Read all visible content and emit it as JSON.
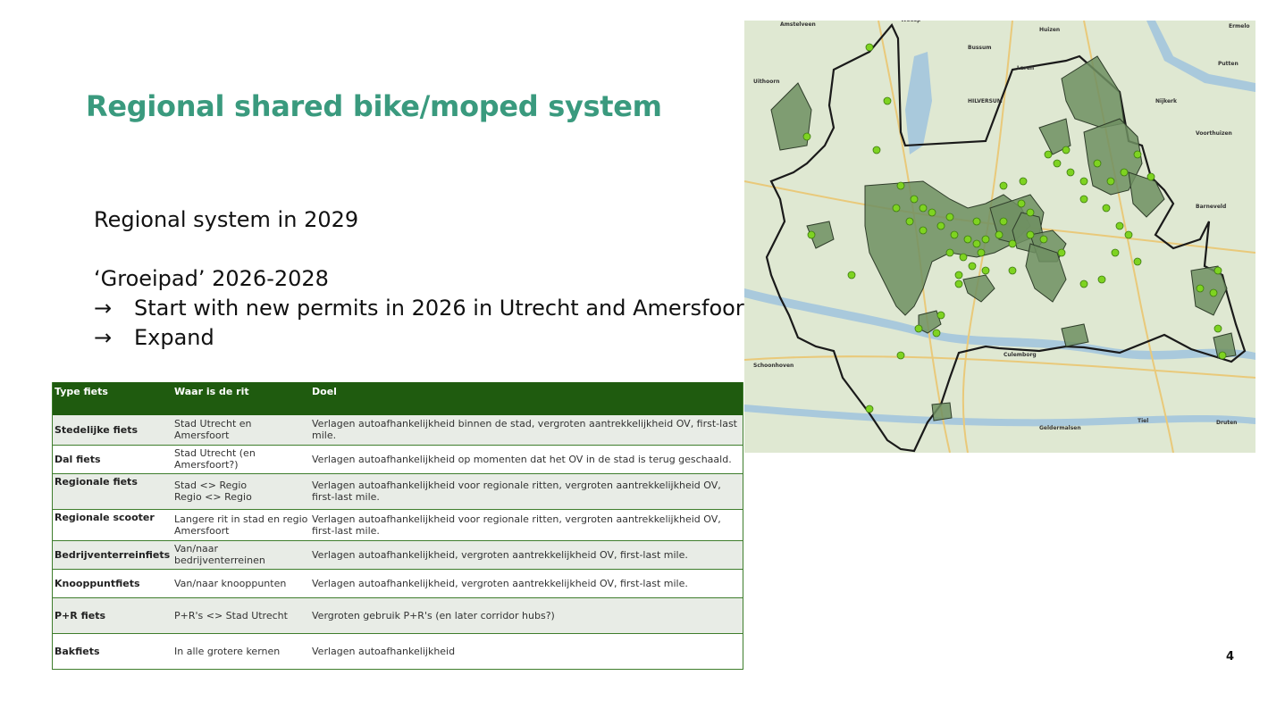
{
  "slide": {
    "title": "Regional shared bike/moped system",
    "lines": [
      "Regional system in 2029",
      "‘Groeipad’ 2026-2028"
    ],
    "bullets": [
      "Start with new permits in 2026 in Utrecht and Amersfoort",
      "Expand"
    ],
    "arrow_glyph": "→",
    "page_number": "4"
  },
  "table": {
    "headers": [
      "Type fiets",
      "Waar is de rit",
      "Doel"
    ],
    "rows": [
      {
        "type": "Stedelijke fiets",
        "where": "Stad Utrecht en Amersfoort",
        "where2": "",
        "goal": "Verlagen autoafhankelijkheid binnen de stad, vergroten aantrekkelijkheid OV, first-last mile."
      },
      {
        "type": "Dal fiets",
        "where": "Stad Utrecht (en Amersfoort?)",
        "where2": "",
        "goal": "Verlagen autoafhankelijkheid op momenten dat het OV in de stad is terug geschaald."
      },
      {
        "type": "Regionale fiets",
        "where": "Stad <> Regio",
        "where2": "Regio <> Regio",
        "goal": "Verlagen autoafhankelijkheid voor regionale ritten, vergroten aantrekkelijkheid OV, first-last mile."
      },
      {
        "type": "Regionale scooter",
        "where": "Langere rit in stad en regio",
        "where2": "Amersfoort",
        "goal": "Verlagen autoafhankelijkheid voor regionale ritten, vergroten aantrekkelijkheid OV, first-last mile."
      },
      {
        "type": "Bedrijventerreinfiets",
        "where": "Van/naar bedrijventerreinen",
        "where2": "",
        "goal": "Verlagen autoafhankelijkheid, vergroten aantrekkelijkheid OV, first-last mile."
      },
      {
        "type": "Knooppuntfiets",
        "where": "Van/naar knooppunten",
        "where2": "",
        "goal": "Verlagen autoafhankelijkheid, vergroten aantrekkelijkheid OV, first-last mile."
      },
      {
        "type": "P+R fiets",
        "where": "P+R's <> Stad Utrecht",
        "where2": "",
        "goal": "Vergroten gebruik P+R's (en later corridor hubs?)"
      },
      {
        "type": "Bakfiets",
        "where": "In alle grotere kernen",
        "where2": "",
        "goal": "Verlagen autoafhankelijkheid"
      }
    ]
  },
  "map": {
    "places": [
      "Amstelveen",
      "Weesp",
      "Huizen",
      "Bussum",
      "Laren",
      "HILVERSUM",
      "Uithoorn",
      "Nijkerk",
      "Putten",
      "Voorthuizen",
      "Barneveld",
      "Culemborg",
      "Schoonhoven",
      "Geldermalsen",
      "Tiel",
      "Druten",
      "Ermelo"
    ],
    "colors": {
      "region_fill": "#6f8f62",
      "dot": "#7ed321",
      "border": "#1a1a1a",
      "water": "#a9c9dc",
      "land": "#dfe8d2"
    }
  }
}
